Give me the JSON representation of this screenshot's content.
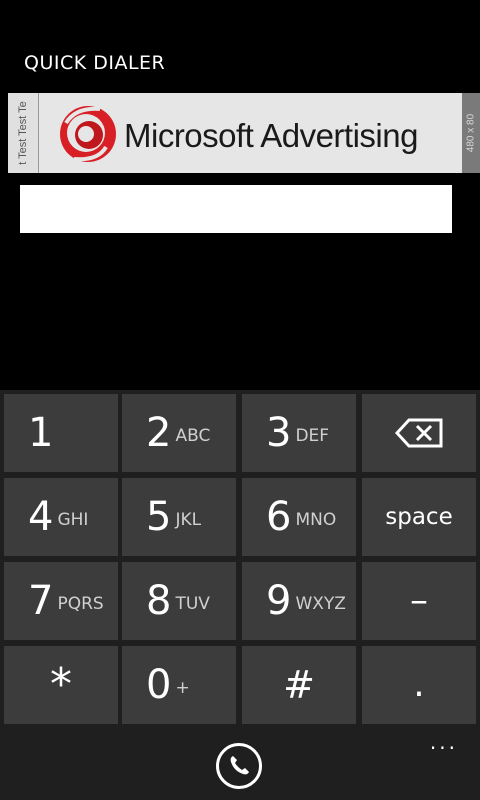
{
  "header": {
    "title": "QUICK DIALER"
  },
  "ad": {
    "brand_text": "Microsoft Advertising",
    "trademark": "®",
    "left_strip_text": "t Test Test Te",
    "size_label": "480 x 80",
    "brand_color": "#d81f26"
  },
  "number_field": {
    "value": ""
  },
  "keypad": {
    "keys": [
      {
        "digit": "1",
        "letters": ""
      },
      {
        "digit": "2",
        "letters": "ABC"
      },
      {
        "digit": "3",
        "letters": "DEF"
      },
      {
        "digit": "4",
        "letters": "GHI"
      },
      {
        "digit": "5",
        "letters": "JKL"
      },
      {
        "digit": "6",
        "letters": "MNO"
      },
      {
        "digit": "7",
        "letters": "PQRS"
      },
      {
        "digit": "8",
        "letters": "TUV"
      },
      {
        "digit": "9",
        "letters": "WXYZ"
      },
      {
        "digit": "*",
        "letters": ""
      },
      {
        "digit": "0",
        "letters": "+"
      },
      {
        "digit": "#",
        "letters": ""
      }
    ],
    "space_label": "space",
    "dash_label": "–",
    "dot_label": "."
  },
  "app_bar": {
    "more_label": "..."
  },
  "colors": {
    "background": "#000000",
    "key": "#3c3c3c",
    "keypad_bg": "#1f1f1f"
  },
  "icons": {
    "backspace": "backspace-icon",
    "call": "phone-icon",
    "ad_logo": "microsoft-advertising-logo-icon"
  }
}
